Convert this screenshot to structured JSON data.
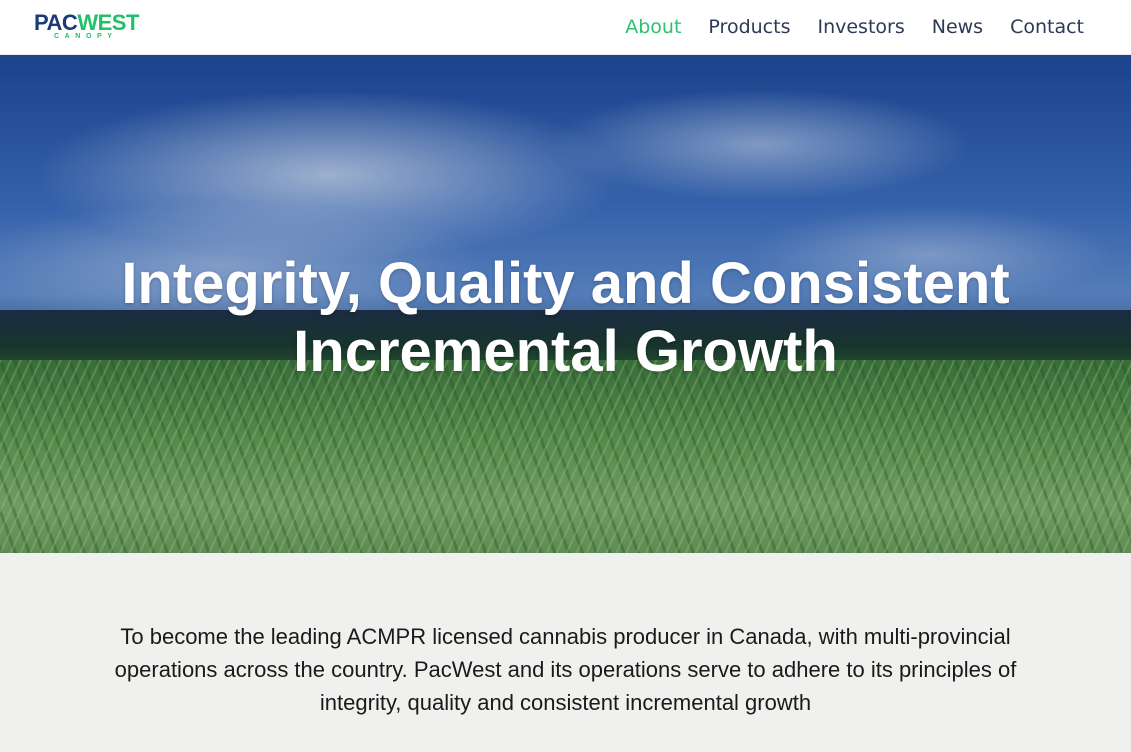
{
  "brand": {
    "logo_primary_a": "PAC",
    "logo_primary_b": "WEST",
    "logo_secondary": "CANOPY",
    "colors": {
      "navy": "#1b3a7a",
      "green": "#21c06a"
    }
  },
  "nav": {
    "items": [
      {
        "label": "About",
        "active": true
      },
      {
        "label": "Products",
        "active": false
      },
      {
        "label": "Investors",
        "active": false
      },
      {
        "label": "News",
        "active": false
      },
      {
        "label": "Contact",
        "active": false
      }
    ],
    "active_color": "#2fbf71",
    "text_color": "#2b3a55"
  },
  "hero": {
    "title_line1": "Integrity, Quality and Consistent",
    "title_line2": "Incremental Growth",
    "background": "sky-and-grass-field-photo"
  },
  "mission": {
    "text": "To become the leading ACMPR licensed cannabis producer in Canada, with multi-provincial operations across the country. PacWest and its operations serve to adhere to its principles of integrity, quality and consistent incremental growth"
  }
}
